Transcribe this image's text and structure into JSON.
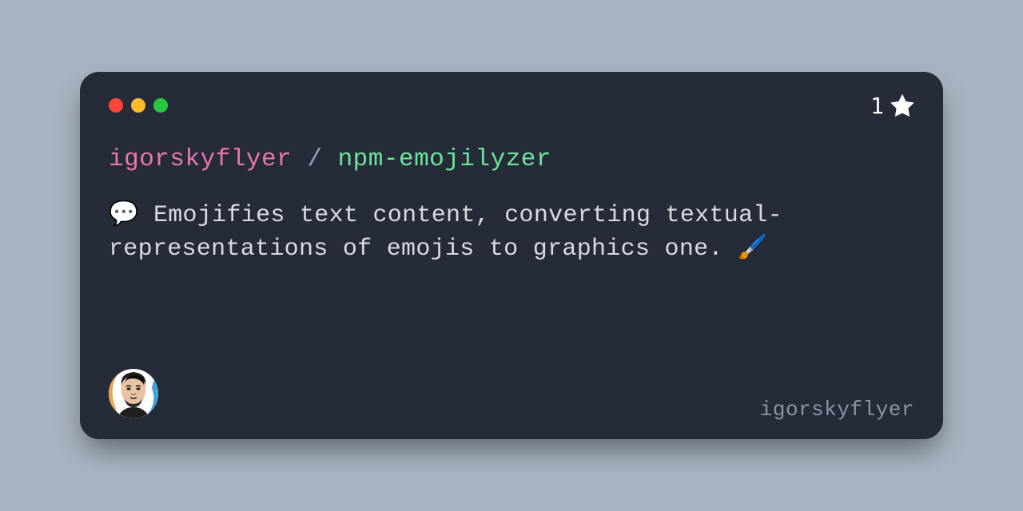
{
  "card": {
    "traffic_lights": [
      "red",
      "yellow",
      "green"
    ],
    "stars": "1",
    "owner": "igorskyflyer",
    "repo": "npm-emojilyzer",
    "slash": " / ",
    "description": "💬 Emojifies text content, converting textual-representations of emojis to graphics one. 🖌️",
    "handle": "igorskyflyer"
  }
}
